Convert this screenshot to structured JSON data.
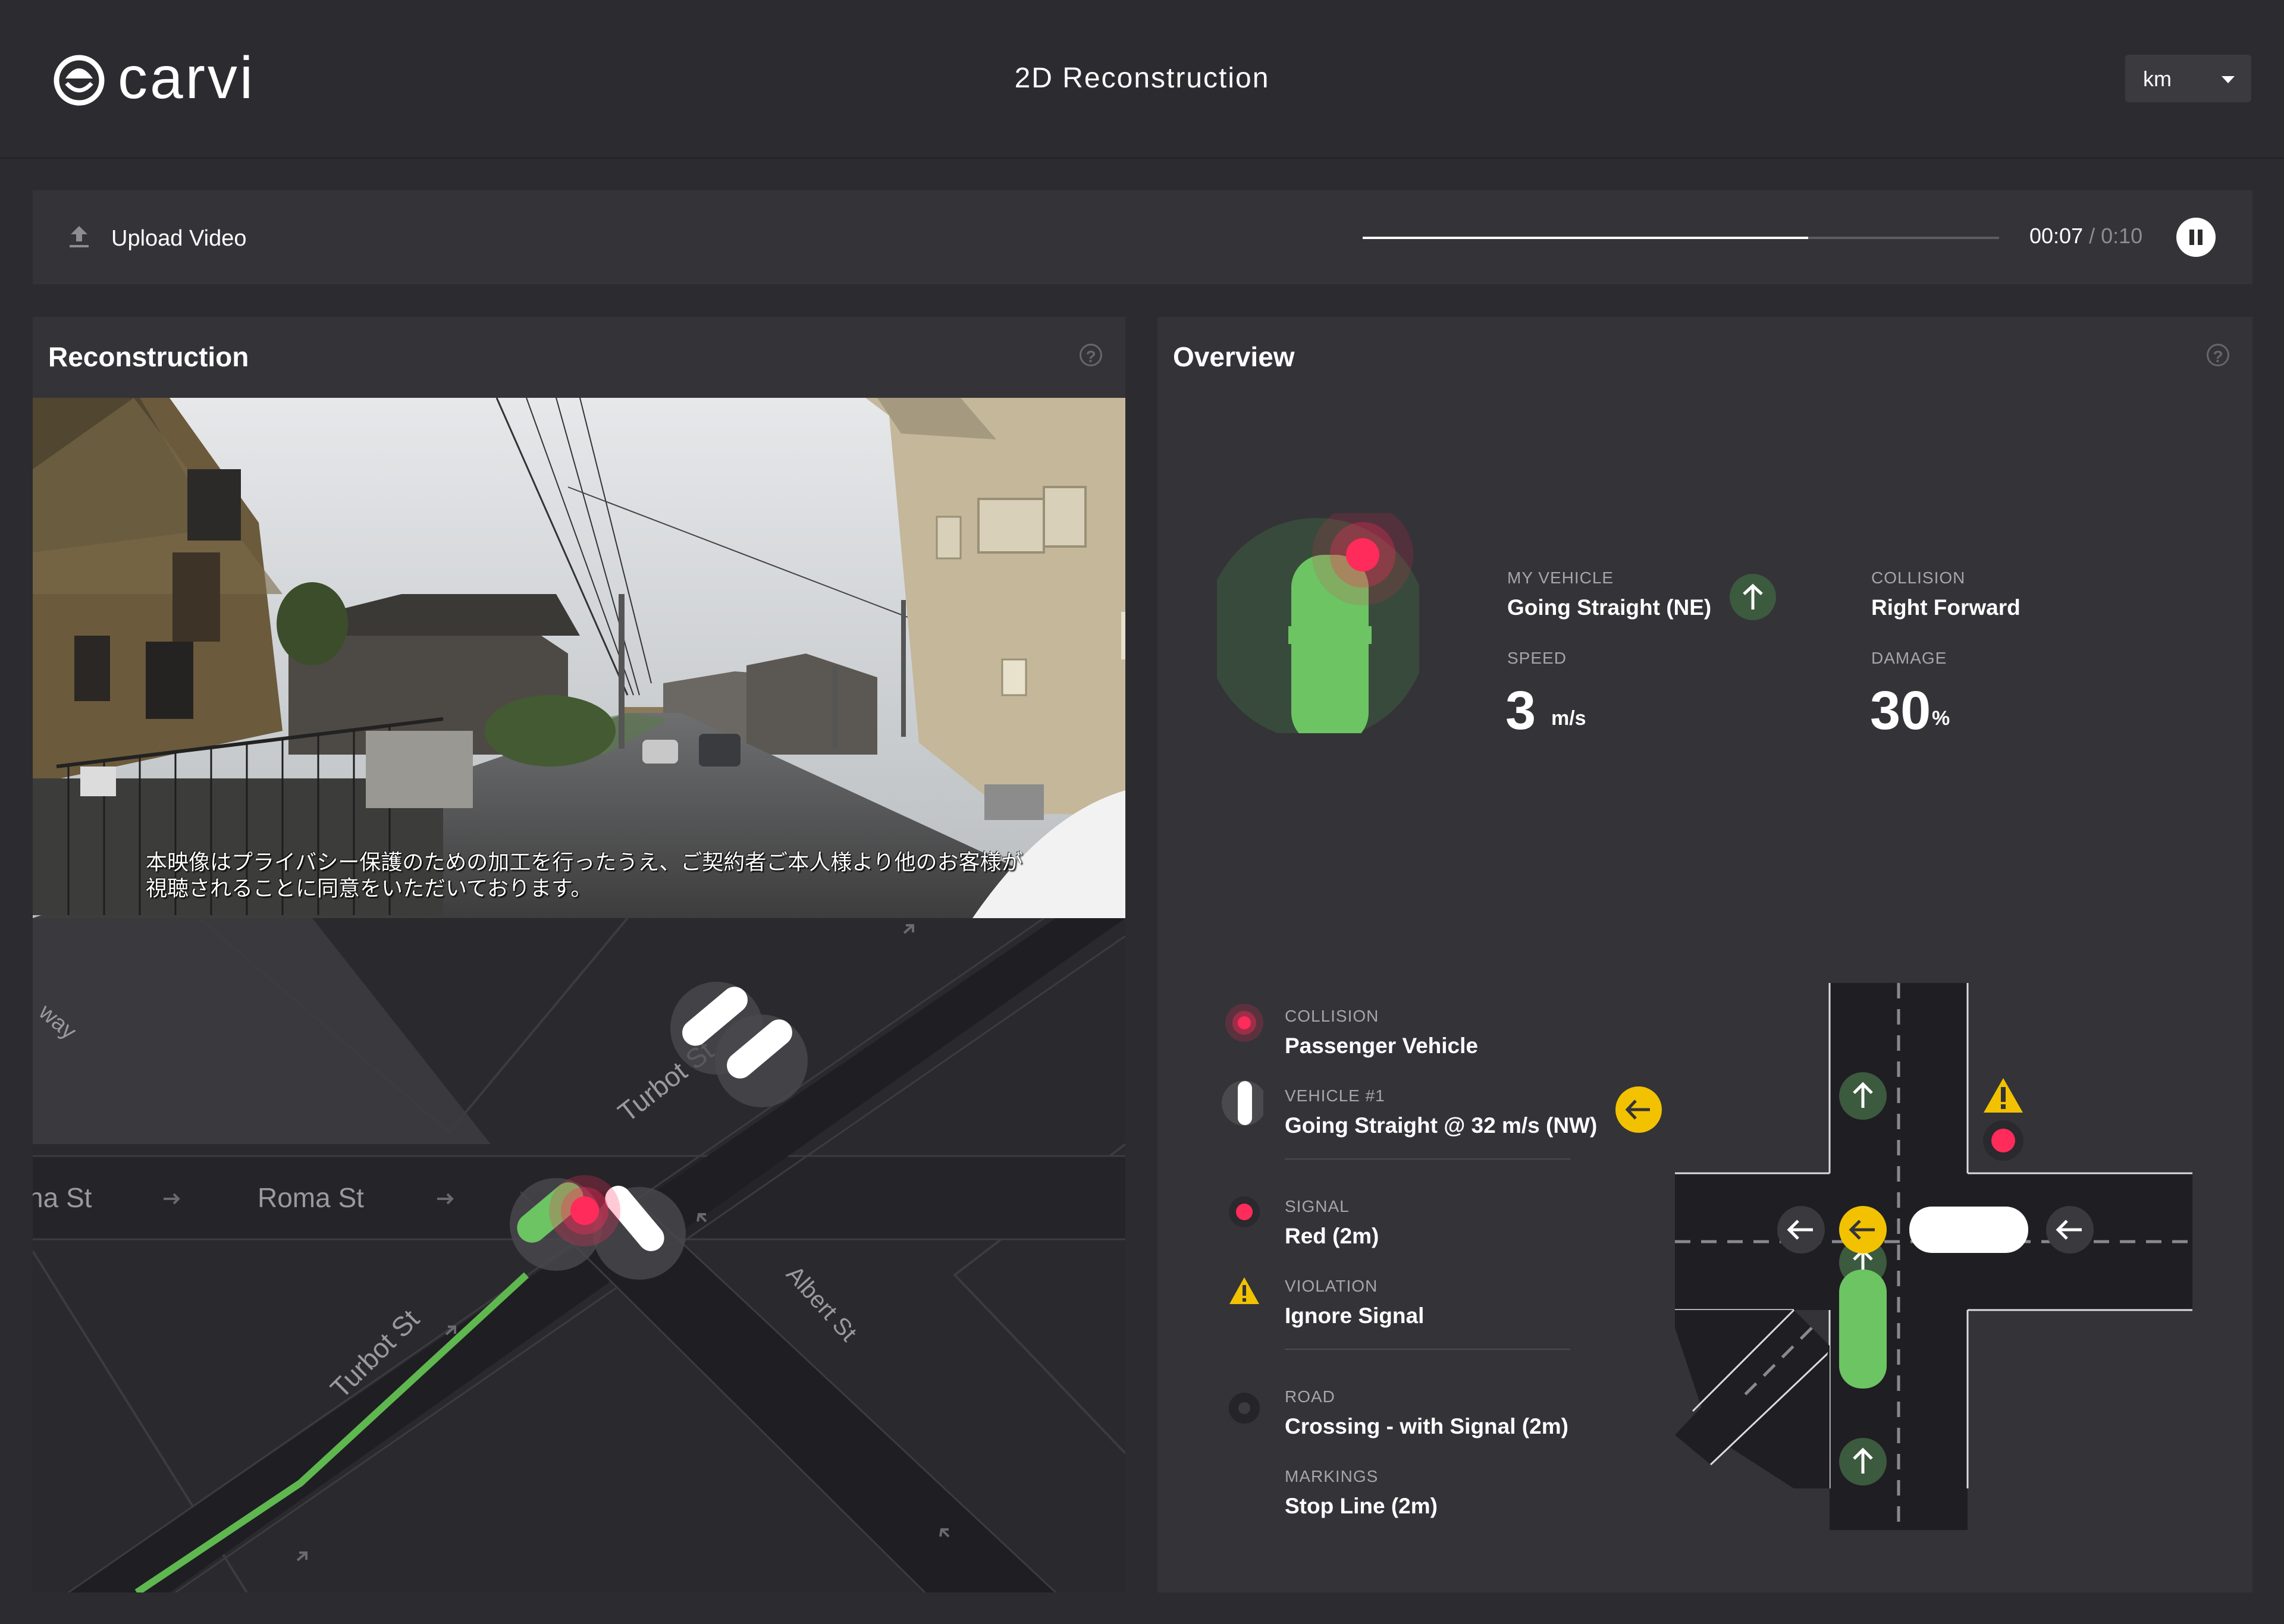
{
  "header": {
    "logo_text": "carvi",
    "title": "2D Reconstruction",
    "units": {
      "selected": "km",
      "icon": "caret-down"
    }
  },
  "toolbar": {
    "upload_label": "Upload Video",
    "upload_icon": "upload",
    "progress": 0.7,
    "time_current": "00:07",
    "time_separator": "/",
    "time_total": "0:10",
    "pause_icon": "pause"
  },
  "reconstruction": {
    "title": "Reconstruction",
    "help_icon": "question-circle",
    "video_subtitle": [
      "本映像はプライバシー保護のための加工を行ったうえ、ご契約者ご本人様より他のお客様が",
      "視聴されることに同意をいただいております。"
    ],
    "map_labels": {
      "way_partial": "way",
      "roma_partial": "na St",
      "roma": "Roma St",
      "turbot_upper": "Turbot St",
      "turbot_lower": "Turbot St",
      "albert": "Albert St"
    }
  },
  "overview": {
    "title": "Overview",
    "help_icon": "question-circle",
    "my_vehicle": {
      "label": "MY VEHICLE",
      "value": "Going Straight  (NE)",
      "icon": "arrow-up"
    },
    "collision_top": {
      "label": "COLLISION",
      "value": "Right Forward"
    },
    "speed": {
      "label": "SPEED",
      "value": "3",
      "unit": "m/s"
    },
    "damage": {
      "label": "DAMAGE",
      "value": "30",
      "unit": "%"
    },
    "details": [
      {
        "label": "COLLISION",
        "value": "Passenger Vehicle",
        "icon": "collision-dot"
      },
      {
        "label": "VEHICLE #1",
        "value": "Going Straight @ 32 m/s (NW)",
        "icon": "vehicle",
        "badge_icon": "arrow-left"
      },
      {
        "label": "SIGNAL",
        "value": "Red (2m)",
        "icon": "red-signal"
      },
      {
        "label": "VIOLATION",
        "value": "Ignore Signal",
        "icon": "warning"
      },
      {
        "label": "ROAD",
        "value": "Crossing - with Signal (2m)",
        "icon": "road-dot"
      },
      {
        "label": "MARKINGS",
        "value": "Stop Line (2m)"
      }
    ],
    "colors": {
      "green": "#6cc463",
      "red": "#ff2b5a",
      "yellow": "#f2c200",
      "dark_green_badge": "#3c5a3e"
    }
  }
}
